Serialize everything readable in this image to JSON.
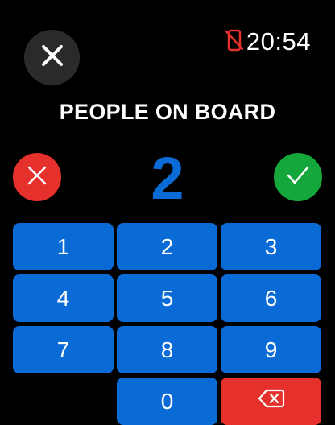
{
  "status": {
    "time": "20:54",
    "phone_icon": "phone-off-icon"
  },
  "title": "PEOPLE ON BOARD",
  "count": "2",
  "colors": {
    "accent": "#0a6bd6",
    "cancel": "#e5302b",
    "confirm": "#14a83c"
  },
  "keypad": {
    "k1": "1",
    "k2": "2",
    "k3": "3",
    "k4": "4",
    "k5": "5",
    "k6": "6",
    "k7": "7",
    "k8": "8",
    "k9": "9",
    "k0": "0"
  }
}
